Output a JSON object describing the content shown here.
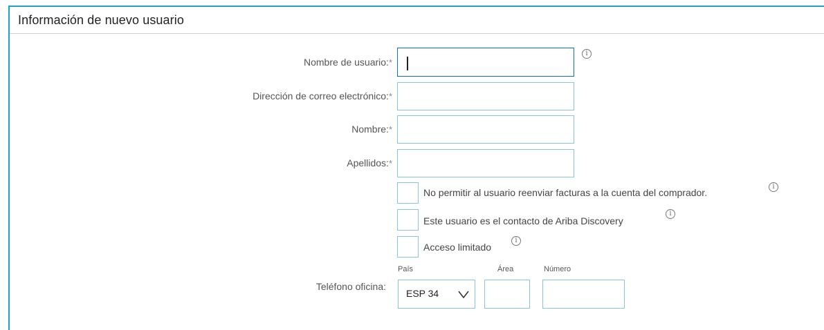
{
  "section": {
    "title": "Información de nuevo usuario"
  },
  "form": {
    "username_label": "Nombre de usuario:",
    "email_label": "Dirección de correo electrónico:",
    "firstname_label": "Nombre:",
    "lastname_label": "Apellidos:",
    "required_mark": "*",
    "username_value": "",
    "email_value": "",
    "firstname_value": "",
    "lastname_value": ""
  },
  "options": [
    {
      "label": "No permitir al usuario reenviar facturas a la cuenta del comprador.",
      "checked": false,
      "has_info": true
    },
    {
      "label": "Este usuario es el contacto de Ariba Discovery",
      "checked": false,
      "has_info": true
    },
    {
      "label": "Acceso limitado",
      "checked": false,
      "has_info": true
    }
  ],
  "phone": {
    "label": "Teléfono oficina:",
    "country_header": "País",
    "area_header": "Área",
    "number_header": "Número",
    "country_value": "ESP 34",
    "area_value": "",
    "number_value": ""
  },
  "icons": {
    "info": "info-circle-icon",
    "chevron": "chevron-down-icon"
  },
  "colors": {
    "accent": "#1fa0c9",
    "input_border": "#89c4de",
    "focus_border": "#0a6ed1"
  }
}
